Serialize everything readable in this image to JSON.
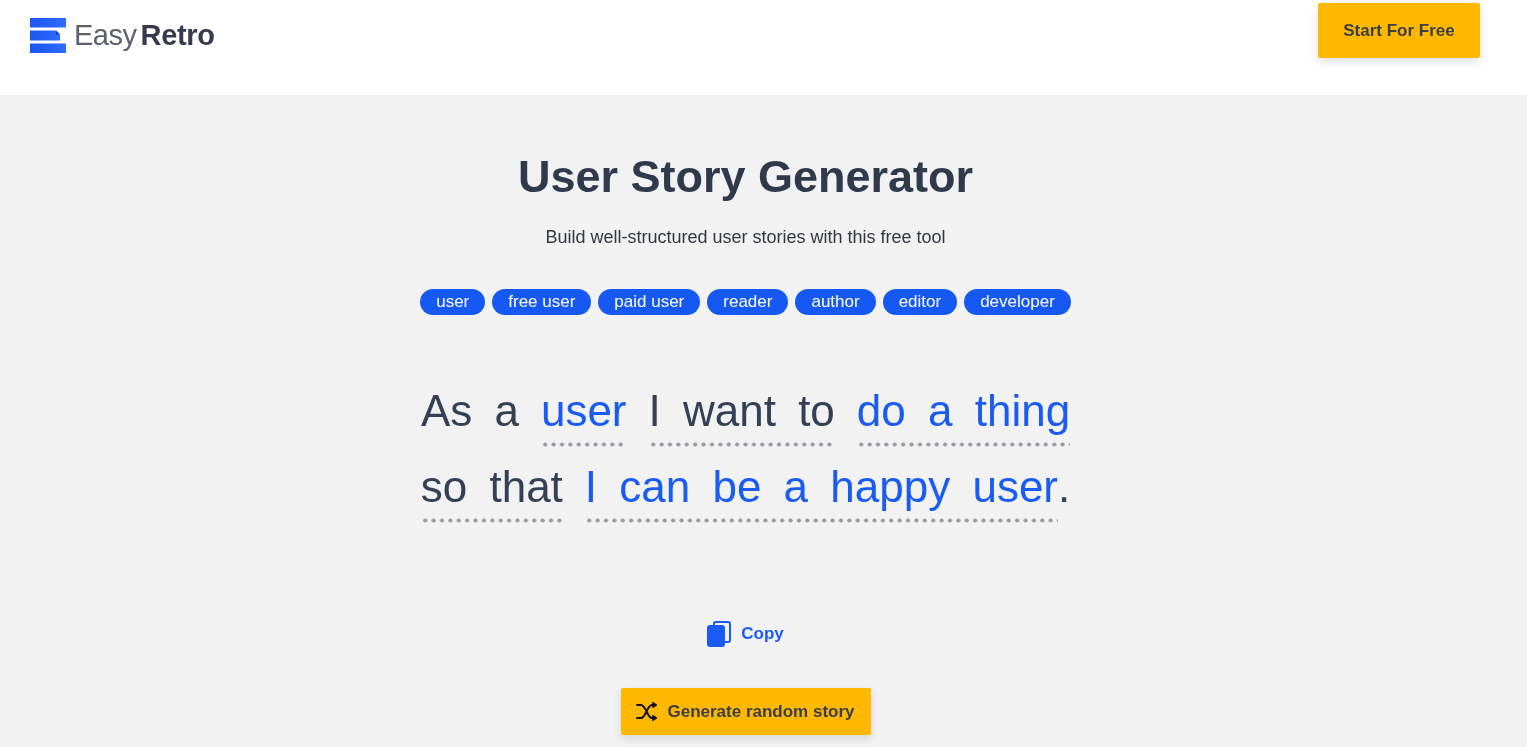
{
  "header": {
    "brand": {
      "light": "Easy",
      "bold": "Retro"
    },
    "cta": "Start For Free"
  },
  "title": "User Story Generator",
  "subtitle": "Build well-structured user stories with this free tool",
  "roles": [
    "user",
    "free user",
    "paid user",
    "reader",
    "author",
    "editor",
    "developer"
  ],
  "story": {
    "lines": [
      [
        {
          "kind": "static",
          "text": "As a"
        },
        {
          "kind": "blank",
          "text": "user"
        },
        {
          "kind": "choice",
          "text": "I want to"
        },
        {
          "kind": "blank",
          "text": "do a thing"
        }
      ],
      [
        {
          "kind": "choice",
          "text": "so that"
        },
        {
          "kind": "blank",
          "text": "I can be a happy user"
        },
        {
          "kind": "punct",
          "text": "."
        }
      ]
    ]
  },
  "copy": "Copy",
  "generate": "Generate random story"
}
